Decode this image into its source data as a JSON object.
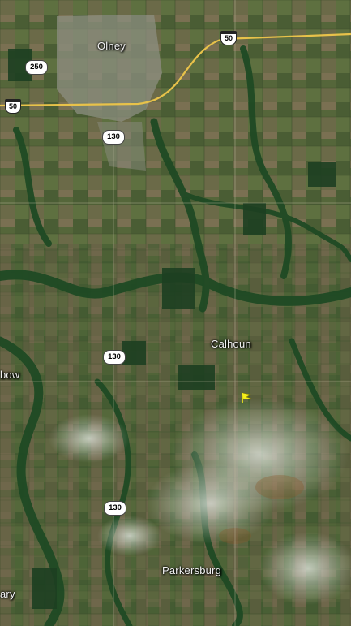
{
  "map": {
    "places": [
      {
        "id": "olney",
        "name": "Olney"
      },
      {
        "id": "calhoun",
        "name": "Calhoun"
      },
      {
        "id": "parkersburg",
        "name": "Parkersburg"
      },
      {
        "id": "bow",
        "name": "bow"
      },
      {
        "id": "ary",
        "name": "ary"
      }
    ],
    "shields": {
      "us50_east": "50",
      "us50_west": "50",
      "il250": "250",
      "il130_north": "130",
      "il130_mid": "130",
      "il130_south": "130"
    },
    "colors": {
      "road": "#e8c24a",
      "marker": "#f4ee1a",
      "cropland": "#5d6a3d",
      "forest": "#1f4a24",
      "town": "#9a9a8c"
    },
    "marker_icon": "location-flag-icon"
  }
}
